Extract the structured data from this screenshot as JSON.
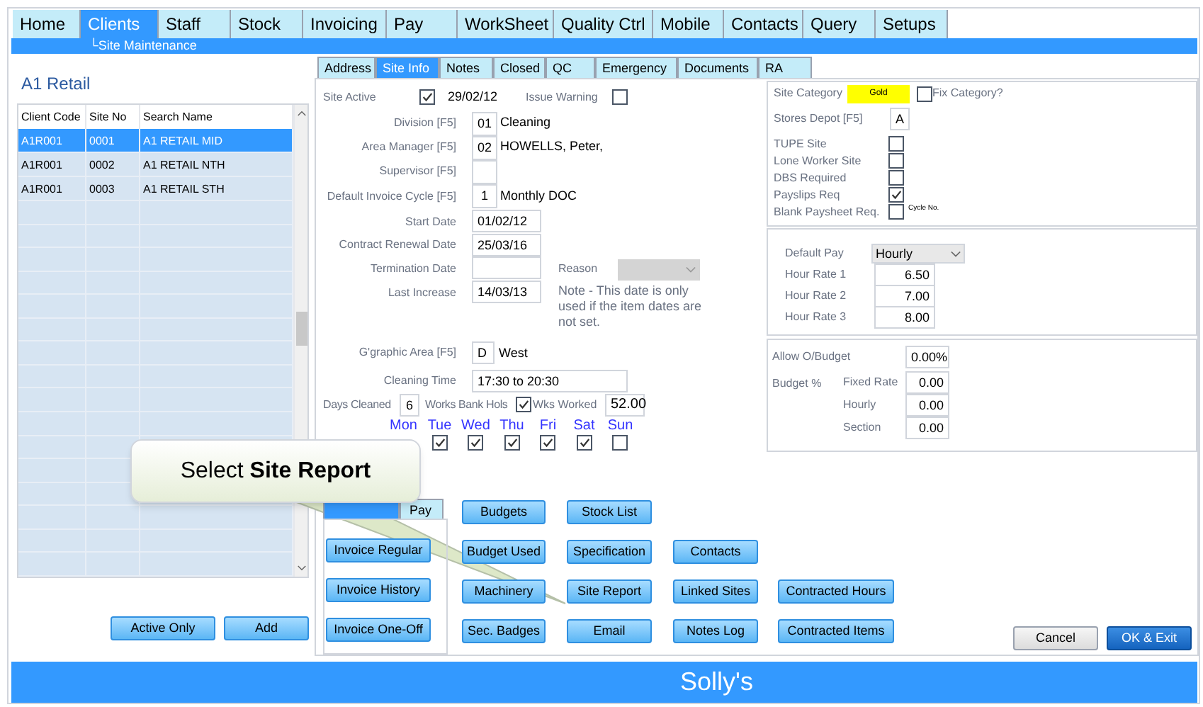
{
  "menu_tabs": [
    {
      "label": "Home",
      "selected": false
    },
    {
      "label": "Clients",
      "selected": true
    },
    {
      "label": "Staff",
      "selected": false
    },
    {
      "label": "Stock",
      "selected": false
    },
    {
      "label": "Invoicing",
      "selected": false
    },
    {
      "label": "Pay",
      "selected": false
    },
    {
      "label": "WorkSheet",
      "selected": false
    },
    {
      "label": "Quality Ctrl",
      "selected": false
    },
    {
      "label": "Mobile",
      "selected": false
    },
    {
      "label": "Contacts",
      "selected": false
    },
    {
      "label": "Query",
      "selected": false
    },
    {
      "label": "Setups",
      "selected": false
    }
  ],
  "breadcrumb": "└Site Maintenance",
  "client_title": "A1 Retail",
  "sites_table": {
    "columns": [
      "Client Code",
      "Site No",
      "Search Name"
    ],
    "rows": [
      {
        "cells": [
          "A1R001",
          "0001",
          "A1 RETAIL MID"
        ],
        "selected": true
      },
      {
        "cells": [
          "A1R001",
          "0002",
          "A1 RETAIL NTH"
        ],
        "selected": false
      },
      {
        "cells": [
          "A1R001",
          "0003",
          "A1 RETAIL STH"
        ],
        "selected": false
      }
    ]
  },
  "left_buttons": [
    "Active Only",
    "Add"
  ],
  "detail_tabs": [
    {
      "label": "Address",
      "selected": false
    },
    {
      "label": "Site Info",
      "selected": true
    },
    {
      "label": "Notes",
      "selected": false
    },
    {
      "label": "Closed",
      "selected": false
    },
    {
      "label": "QC",
      "selected": false
    },
    {
      "label": "Emergency",
      "selected": false
    },
    {
      "label": "Documents",
      "selected": false
    },
    {
      "label": "RA",
      "selected": false
    }
  ],
  "site_active": {
    "label": "Site Active",
    "checked": true,
    "date": "29/02/12"
  },
  "issue_warning": {
    "label": "Issue Warning",
    "checked": false
  },
  "code_fields": [
    {
      "label": "Division [F5]",
      "code": "01",
      "text": "Cleaning"
    },
    {
      "label": "Area Manager [F5]",
      "code": "02",
      "text": "HOWELLS, Peter,"
    },
    {
      "label": "Supervisor [F5]"
    },
    {
      "label": "Default Invoice Cycle [F5]",
      "code": "1",
      "text": "Monthly DOC"
    }
  ],
  "dates": [
    {
      "label": "Start Date",
      "value": "01/02/12"
    },
    {
      "label": "Contract Renewal Date",
      "value": "25/03/16"
    },
    {
      "label": "Termination Date"
    },
    {
      "label": "Last Increase",
      "value": "14/03/13"
    }
  ],
  "reason": {
    "label": "Reason",
    "disabled": true
  },
  "note": "Note - This date is only used if the item dates are not set.",
  "geo_area": {
    "label": "G'graphic Area [F5]",
    "code": "D",
    "text": "West"
  },
  "cleaning_time": {
    "label": "Cleaning Time",
    "value": "17:30 to 20:30"
  },
  "days_cleaned": {
    "label": "Days Cleaned",
    "value": "6"
  },
  "works_bank_hols": {
    "label": "Works Bank Hols",
    "checked": true
  },
  "wks_worked": {
    "label": "Wks Worked",
    "value": "52.00"
  },
  "days": [
    {
      "label": "Mon"
    },
    {
      "label": "Tue",
      "checked": true
    },
    {
      "label": "Wed",
      "checked": true
    },
    {
      "label": "Thu",
      "checked": true
    },
    {
      "label": "Fri",
      "checked": true
    },
    {
      "label": "Sat",
      "checked": true
    },
    {
      "label": "Sun",
      "checked": false
    }
  ],
  "site_category": {
    "label": "Site Category",
    "value": "Gold",
    "color": "#ffff00"
  },
  "fix_category": {
    "label": "Fix Category?",
    "checked": false
  },
  "stores_depot": {
    "label": "Stores Depot [F5]",
    "value": "A"
  },
  "flags": [
    {
      "label": "TUPE Site",
      "checked": false
    },
    {
      "label": "Lone Worker Site",
      "checked": false
    },
    {
      "label": "DBS Required",
      "checked": false
    },
    {
      "label": "Payslips Req",
      "checked": true
    },
    {
      "label": "Blank Paysheet Req.",
      "checked": false
    }
  ],
  "cycle_no_label": "Cycle No.",
  "default_pay": {
    "label": "Default Pay",
    "value": "Hourly"
  },
  "hour_rates": [
    {
      "label": "Hour Rate 1",
      "value": "6.50"
    },
    {
      "label": "Hour Rate 2",
      "value": "7.00"
    },
    {
      "label": "Hour Rate 3",
      "value": "8.00"
    }
  ],
  "allow_budget": {
    "label": "Allow O/Budget",
    "value": "0.00%"
  },
  "budget_label": "Budget %",
  "budget_rows": [
    {
      "label": "Fixed Rate",
      "value": "0.00"
    },
    {
      "label": "Hourly",
      "value": "0.00"
    },
    {
      "label": "Section",
      "value": "0.00"
    }
  ],
  "invoice_tabs": [
    {
      "selected": true
    },
    {
      "label": "Pay",
      "selected": false
    }
  ],
  "invoice_buttons": [
    "Invoice Regular",
    "Invoice History",
    "Invoice One-Off"
  ],
  "action_buttons": [
    [
      "Budgets",
      "Stock List"
    ],
    [
      "Budget Used",
      "Specification",
      "Contacts"
    ],
    [
      "Machinery",
      "Site Report",
      "Linked Sites",
      "Contracted Hours"
    ],
    [
      "Sec. Badges",
      "Email",
      "Notes Log",
      "Contracted Items"
    ]
  ],
  "dialog_buttons": [
    {
      "label": "Cancel",
      "kind": "normal"
    },
    {
      "label": "OK & Exit",
      "kind": "default"
    }
  ],
  "callout": "Select **Site Report**",
  "footer": "Solly's"
}
